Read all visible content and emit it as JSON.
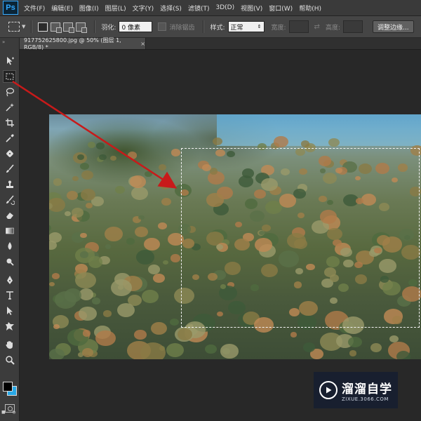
{
  "app": {
    "logo": "Ps"
  },
  "menu": [
    "文件(F)",
    "编辑(E)",
    "图像(I)",
    "图层(L)",
    "文字(Y)",
    "选择(S)",
    "滤镜(T)",
    "3D(D)",
    "视图(V)",
    "窗口(W)",
    "帮助(H)"
  ],
  "options": {
    "feather_label": "羽化:",
    "feather_value": "0 像素",
    "antialias_label": "消除锯齿",
    "style_label": "样式:",
    "style_value": "正常",
    "width_label": "宽度:",
    "height_label": "高度:",
    "refine_edge_label": "调整边缘..."
  },
  "document": {
    "tab_title": "917752625800.jpg @ 50% (图层 1, RGB/8) *",
    "close_glyph": "×"
  },
  "toolbox": {
    "tools": [
      "move-tool",
      "rectangular-marquee-tool",
      "lasso-tool",
      "quick-selection-tool",
      "crop-tool",
      "eyedropper-tool",
      "healing-brush-tool",
      "brush-tool",
      "clone-stamp-tool",
      "history-brush-tool",
      "eraser-tool",
      "gradient-tool",
      "blur-tool",
      "dodge-tool",
      "pen-tool",
      "type-tool",
      "path-selection-tool",
      "shape-tool",
      "hand-tool",
      "zoom-tool"
    ],
    "selected": "rectangular-marquee-tool",
    "foreground_color": "#000000",
    "background_color": "#29a8e6"
  },
  "annotation": {
    "arrow_color": "#c81a1a"
  },
  "watermark": {
    "title": "溜溜自学",
    "subtitle": "ZIXUE.3066.COM"
  }
}
